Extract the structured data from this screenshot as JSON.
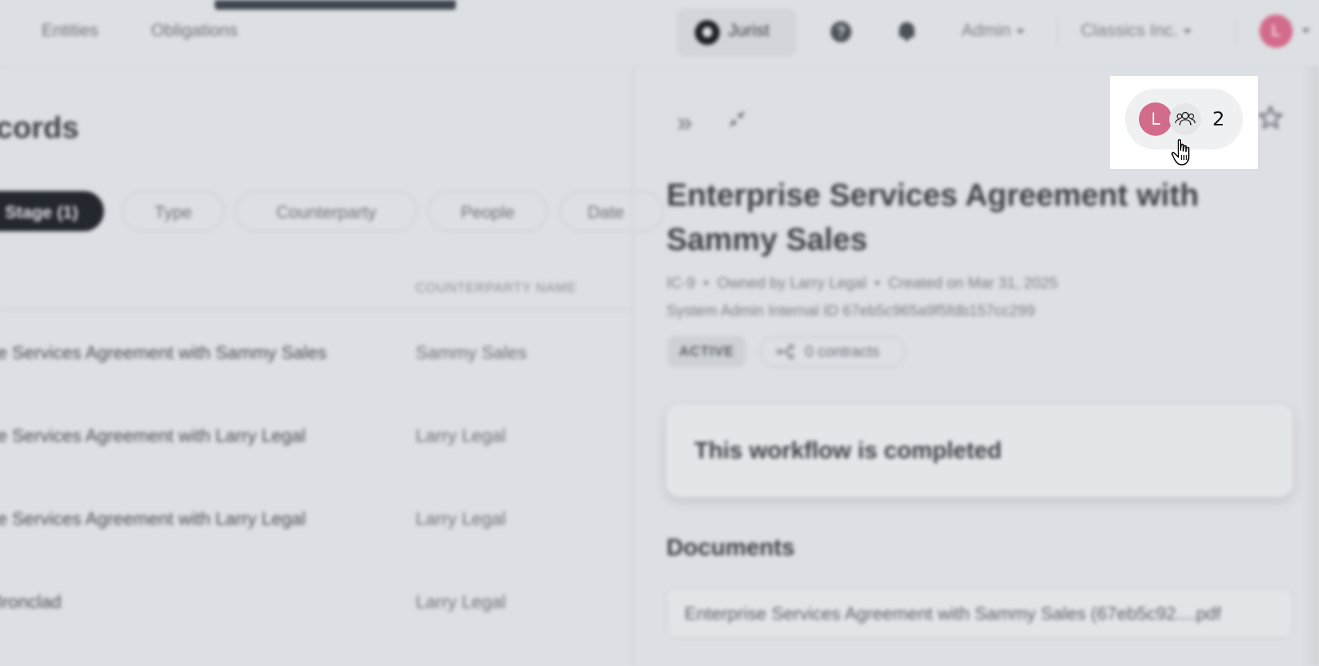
{
  "nav": {
    "links": [
      "Entities",
      "Obligations"
    ],
    "jurist_label": "Jurist",
    "admin_label": "Admin",
    "org_label": "Classics Inc.",
    "user_initial": "L"
  },
  "list": {
    "title_partial": "cords",
    "filters": [
      {
        "label": "Stage (1)",
        "active": true
      },
      {
        "label": "Type",
        "active": false
      },
      {
        "label": "Counterparty",
        "active": false
      },
      {
        "label": "People",
        "active": false
      },
      {
        "label": "Date",
        "active": false
      }
    ],
    "column_header": "COUNTERPARTY NAME",
    "rows": [
      {
        "title": "e Services Agreement with Sammy Sales",
        "counterparty": "Sammy Sales"
      },
      {
        "title": "e Services Agreement with Larry Legal",
        "counterparty": "Larry Legal"
      },
      {
        "title": "e Services Agreement with Larry Legal",
        "counterparty": "Larry Legal"
      },
      {
        "title": "Ironclad",
        "counterparty": "Larry Legal"
      }
    ]
  },
  "detail": {
    "title": "Enterprise Services Agreement with Sammy Sales",
    "record_id": "IC-9",
    "owner": "Owned by Larry Legal",
    "created": "Created on Mar 31, 2025",
    "system_id": "System Admin Internal ID 67eb5c965a9f5fdb157cc299",
    "status": "ACTIVE",
    "contracts": "0 contracts",
    "workflow_message": "This workflow is completed",
    "documents_heading": "Documents",
    "document_name": "Enterprise Services Agreement with Sammy Sales (67eb5c92....pdf",
    "viewer_initial": "L",
    "viewer_count": "2"
  },
  "colors": {
    "avatar": "#d36b8b",
    "active_chip": "#23272e"
  },
  "icons": [
    "double-chevron-right-icon",
    "collapse-icon",
    "help-icon",
    "bell-icon",
    "group-icon",
    "star-icon",
    "share-icon",
    "hand-cursor-icon"
  ]
}
